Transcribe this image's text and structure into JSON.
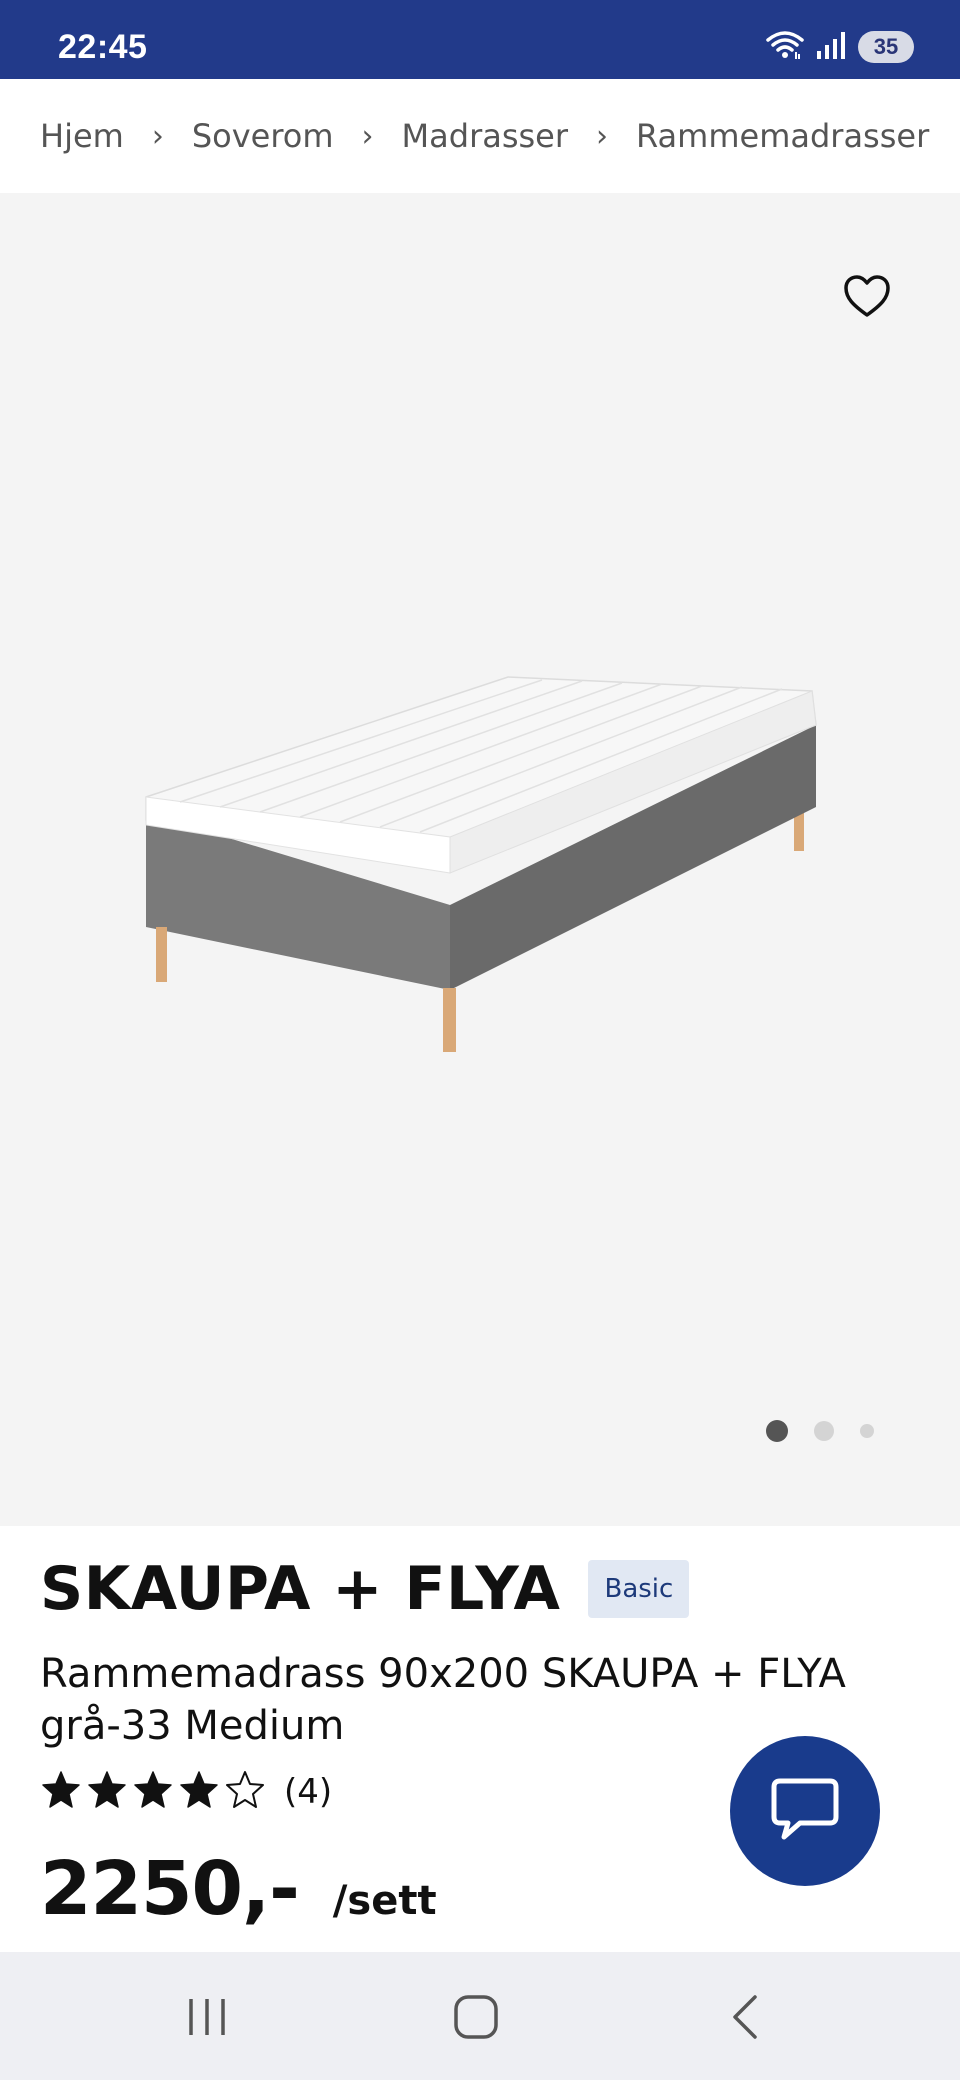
{
  "status_bar": {
    "time": "22:45",
    "battery": "35",
    "icons": [
      "wifi-icon",
      "signal-icon",
      "battery-icon"
    ]
  },
  "breadcrumb": {
    "items": [
      {
        "label": "Hjem"
      },
      {
        "label": "Soverom"
      },
      {
        "label": "Madrasser"
      },
      {
        "label": "Rammemadrasser"
      }
    ]
  },
  "gallery": {
    "image_count": 3,
    "active_index": 0,
    "favorite_icon": "heart-outline-icon"
  },
  "product": {
    "name": "SKAUPA + FLYA",
    "badge": "Basic",
    "description_line1": "Rammemadrass 90x200 SKAUPA + FLYA",
    "description_line2": "grå-33 Medium",
    "rating": 4,
    "rating_max": 5,
    "review_count": "(4)",
    "price": "2250,-",
    "unit": "/sett"
  },
  "chat": {
    "icon": "chat-bubble-icon"
  },
  "colors": {
    "status_bar": "#223a8a",
    "brand_blue": "#193b8c",
    "badge_bg": "#e1e8f3",
    "badge_text": "#1d3a7a",
    "hero_bg": "#f4f4f4"
  },
  "nav": {
    "icons": [
      "recent-apps-icon",
      "home-icon",
      "back-icon"
    ]
  }
}
